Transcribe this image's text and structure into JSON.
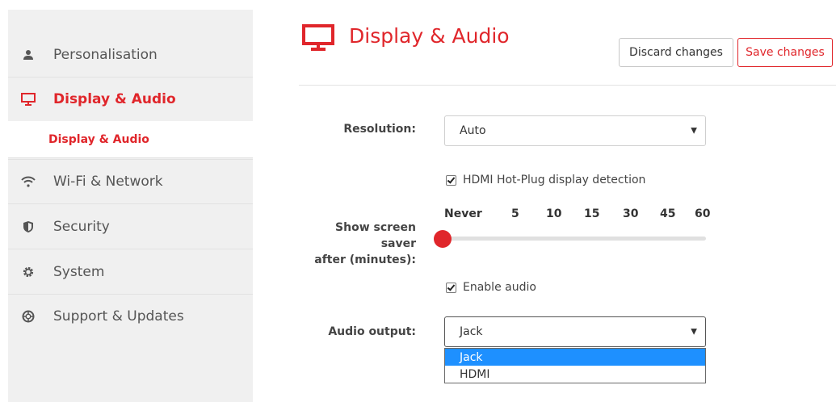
{
  "sidebar": {
    "items": [
      {
        "label": "Personalisation",
        "icon": "person-icon"
      },
      {
        "label": "Display & Audio",
        "icon": "monitor-icon"
      },
      {
        "label": "Wi-Fi & Network",
        "icon": "wifi-icon"
      },
      {
        "label": "Security",
        "icon": "shield-icon"
      },
      {
        "label": "System",
        "icon": "gear-icon"
      },
      {
        "label": "Support & Updates",
        "icon": "lifebuoy-icon"
      }
    ],
    "subitem": "Display & Audio"
  },
  "header": {
    "title": "Display & Audio",
    "discard_label": "Discard changes",
    "save_label": "Save changes"
  },
  "form": {
    "resolution_label": "Resolution:",
    "resolution_value": "Auto",
    "hdmi_hotplug_label": "HDMI Hot-Plug display detection",
    "hdmi_hotplug_checked": true,
    "screensaver_label_line1": "Show screen saver",
    "screensaver_label_line2": "after (minutes):",
    "screensaver_ticks": [
      "Never",
      "5",
      "10",
      "15",
      "30",
      "45",
      "60"
    ],
    "screensaver_value": "Never",
    "enable_audio_label": "Enable audio",
    "enable_audio_checked": true,
    "audio_output_label": "Audio output:",
    "audio_output_value": "Jack",
    "audio_output_options": [
      "Jack",
      "HDMI"
    ]
  },
  "colors": {
    "accent": "#e0262b",
    "selected_option": "#1e90ff"
  }
}
